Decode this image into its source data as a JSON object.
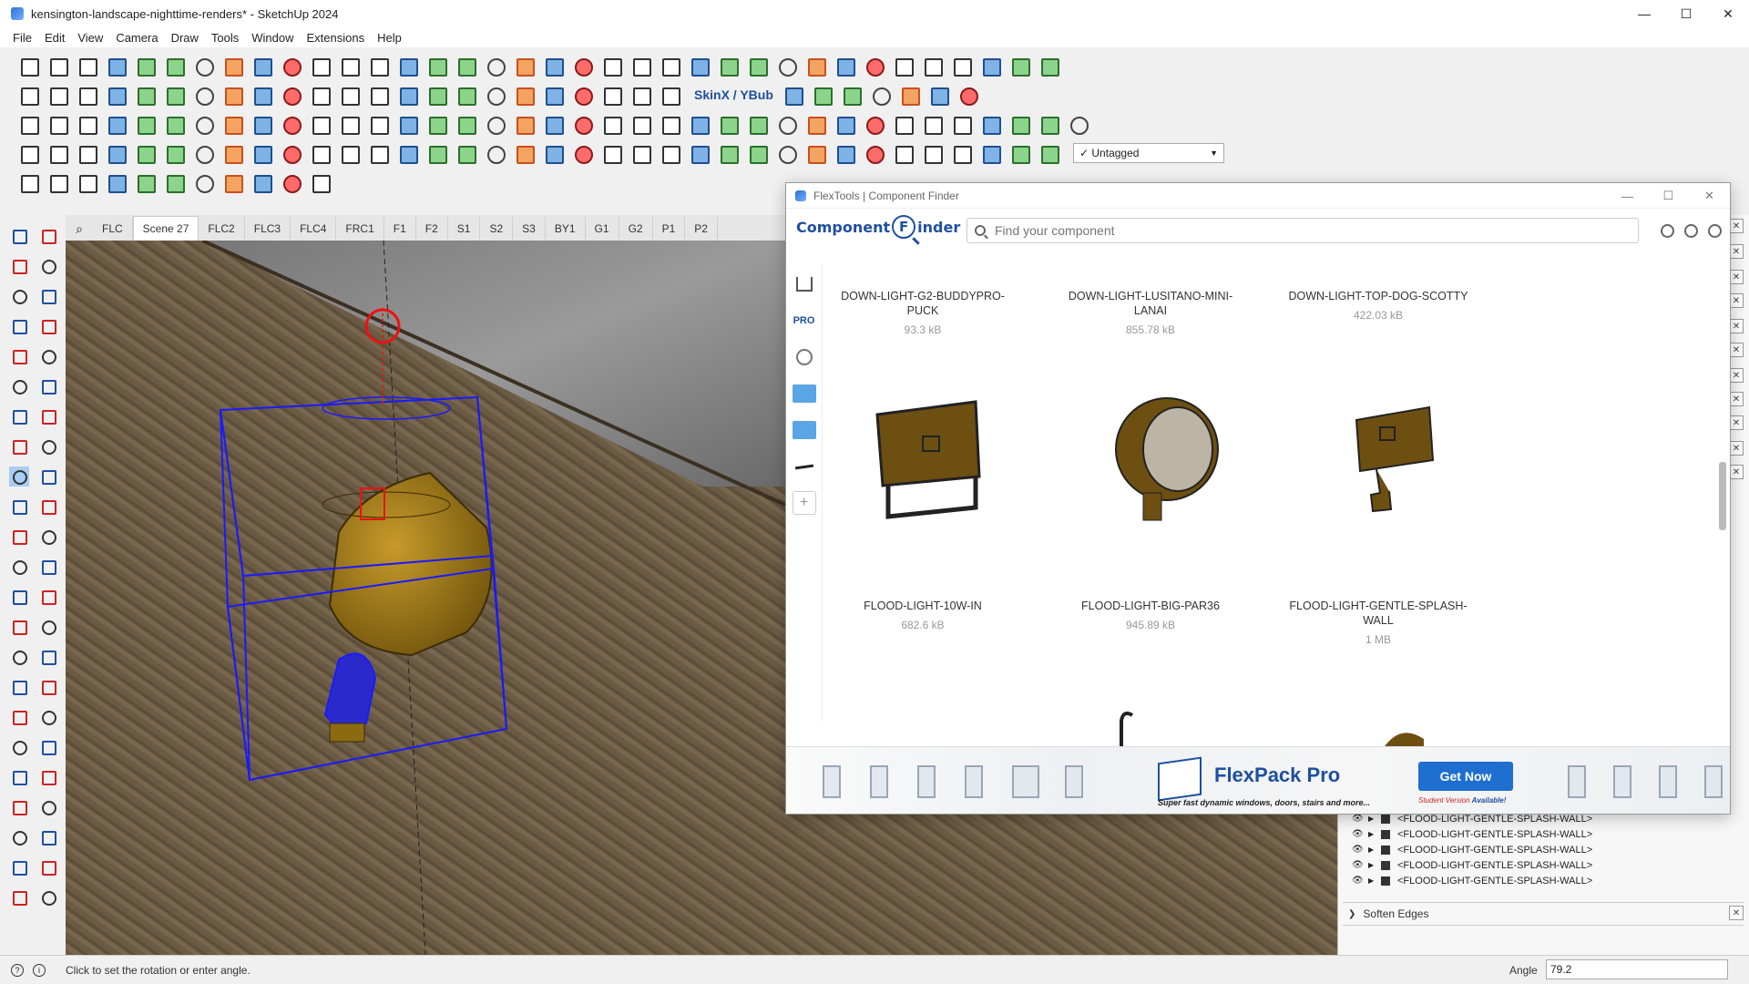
{
  "window": {
    "title": "kensington-landscape-nighttime-renders* - SketchUp 2024",
    "controls": [
      "—",
      "☐",
      "✕"
    ]
  },
  "menu": [
    "File",
    "Edit",
    "View",
    "Camera",
    "Draw",
    "Tools",
    "Window",
    "Extensions",
    "Help"
  ],
  "toolbar": {
    "skinx_label": "SkinX / YBub",
    "tag_dropdown": "✓ Untagged"
  },
  "scene_tabs": [
    "FLC",
    "Scene 27",
    "FLC2",
    "FLC3",
    "FLC4",
    "FRC1",
    "F1",
    "F2",
    "S1",
    "S2",
    "S3",
    "BY1",
    "G1",
    "G2",
    "P1",
    "P2"
  ],
  "active_scene": "Scene 27",
  "status": {
    "message": "Click to set the rotation or enter angle.",
    "vcb_label": "Angle",
    "vcb_value": "79.2"
  },
  "tray": {
    "outliner_rows": [
      "<FLOOD-LIGHT-GENTLE-SPLASH-WALL>",
      "<FLOOD-LIGHT-GENTLE-SPLASH-WALL>",
      "<FLOOD-LIGHT-GENTLE-SPLASH-WALL>",
      "<FLOOD-LIGHT-GENTLE-SPLASH-WALL>",
      "<FLOOD-LIGHT-GENTLE-SPLASH-WALL>"
    ],
    "soften_edges": "Soften Edges"
  },
  "finder": {
    "window_title": "FlexTools | Component Finder",
    "logo_left": "Component",
    "logo_mid": "F",
    "logo_right": "inder",
    "search_placeholder": "Find your component",
    "sidebar_pro": "PRO",
    "items": [
      {
        "name": "DOWN-LIGHT-G2-BUDDYPRO-PUCK",
        "size": "93.3 kB"
      },
      {
        "name": "DOWN-LIGHT-LUSITANO-MINI-LANAI",
        "size": "855.78 kB"
      },
      {
        "name": "DOWN-LIGHT-TOP-DOG-SCOTTY",
        "size": "422.03 kB"
      },
      {
        "name": "FLOOD-LIGHT-10W-IN",
        "size": "682.6 kB"
      },
      {
        "name": "FLOOD-LIGHT-BIG-PAR36",
        "size": "945.89 kB"
      },
      {
        "name": "FLOOD-LIGHT-GENTLE-SPLASH-WALL",
        "size": "1 MB"
      }
    ],
    "banner": {
      "title": "FlexPack Pro",
      "subtitle": "Super fast dynamic windows, doors, stairs and more...",
      "button": "Get Now",
      "student_a": "Student Version",
      "student_b": " Available!"
    }
  },
  "colors": {
    "selection": "#1a1aff",
    "fixture": "#8b6a12",
    "accent": "#1e4fa0",
    "button": "#1e6fd0"
  }
}
